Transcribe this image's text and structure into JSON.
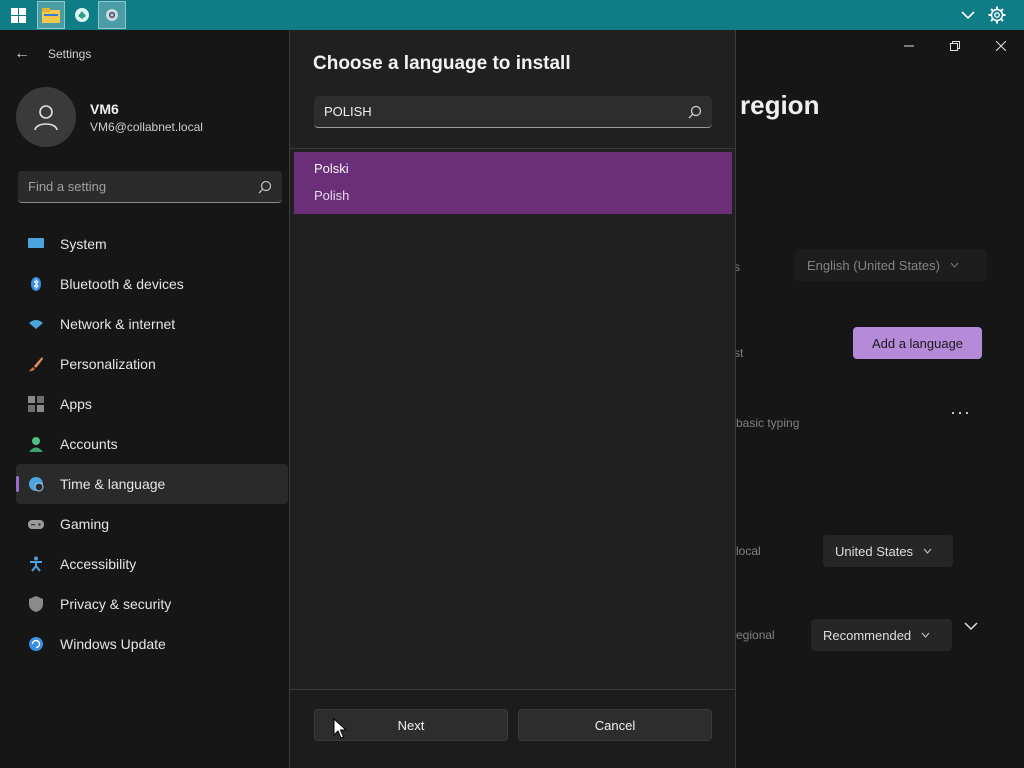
{
  "taskbar": {
    "icons": [
      "windows-logo",
      "file-explorer",
      "app",
      "settings"
    ],
    "tray_icons": [
      "chevron-down",
      "gear"
    ]
  },
  "settings": {
    "title": "Settings",
    "user": {
      "name": "VM6",
      "email": "VM6@collabnet.local"
    },
    "search_placeholder": "Find a setting",
    "nav": [
      {
        "label": "System",
        "icon": "system-icon",
        "color": "#4aa3df"
      },
      {
        "label": "Bluetooth & devices",
        "icon": "bluetooth-icon",
        "color": "#3a8ee6"
      },
      {
        "label": "Network & internet",
        "icon": "network-icon",
        "color": "#4aa3df"
      },
      {
        "label": "Personalization",
        "icon": "brush-icon",
        "color": "#e88d5d"
      },
      {
        "label": "Apps",
        "icon": "apps-icon",
        "color": "#8a8a8a"
      },
      {
        "label": "Accounts",
        "icon": "person-icon",
        "color": "#4fbf88"
      },
      {
        "label": "Time & language",
        "icon": "globe-clock-icon",
        "color": "#4aa3df",
        "selected": true
      },
      {
        "label": "Gaming",
        "icon": "gamepad-icon",
        "color": "#9a9a9a"
      },
      {
        "label": "Accessibility",
        "icon": "accessibility-icon",
        "color": "#4aa3df"
      },
      {
        "label": "Privacy & security",
        "icon": "shield-icon",
        "color": "#8a8a8a"
      },
      {
        "label": "Windows Update",
        "icon": "update-icon",
        "color": "#3a8ee6"
      }
    ],
    "page_heading": "region",
    "rows": {
      "display_lang_label_fragment": "s",
      "display_lang_value": "English (United States)",
      "preferred_label_fragment": "st",
      "add_language": "Add a language",
      "typing_fragment": "basic typing",
      "country_label_fragment": "local",
      "country_value": "United States",
      "format_label_fragment": "egional",
      "format_value": "Recommended"
    }
  },
  "dialog": {
    "title": "Choose a language to install",
    "search_value": "POLISH",
    "results": [
      {
        "native": "Polski",
        "english": "Polish"
      }
    ],
    "next_label": "Next",
    "cancel_label": "Cancel"
  },
  "colors": {
    "accent": "#9b6bd1",
    "selection": "#6b2e78",
    "taskbar": "#0e7d86"
  }
}
